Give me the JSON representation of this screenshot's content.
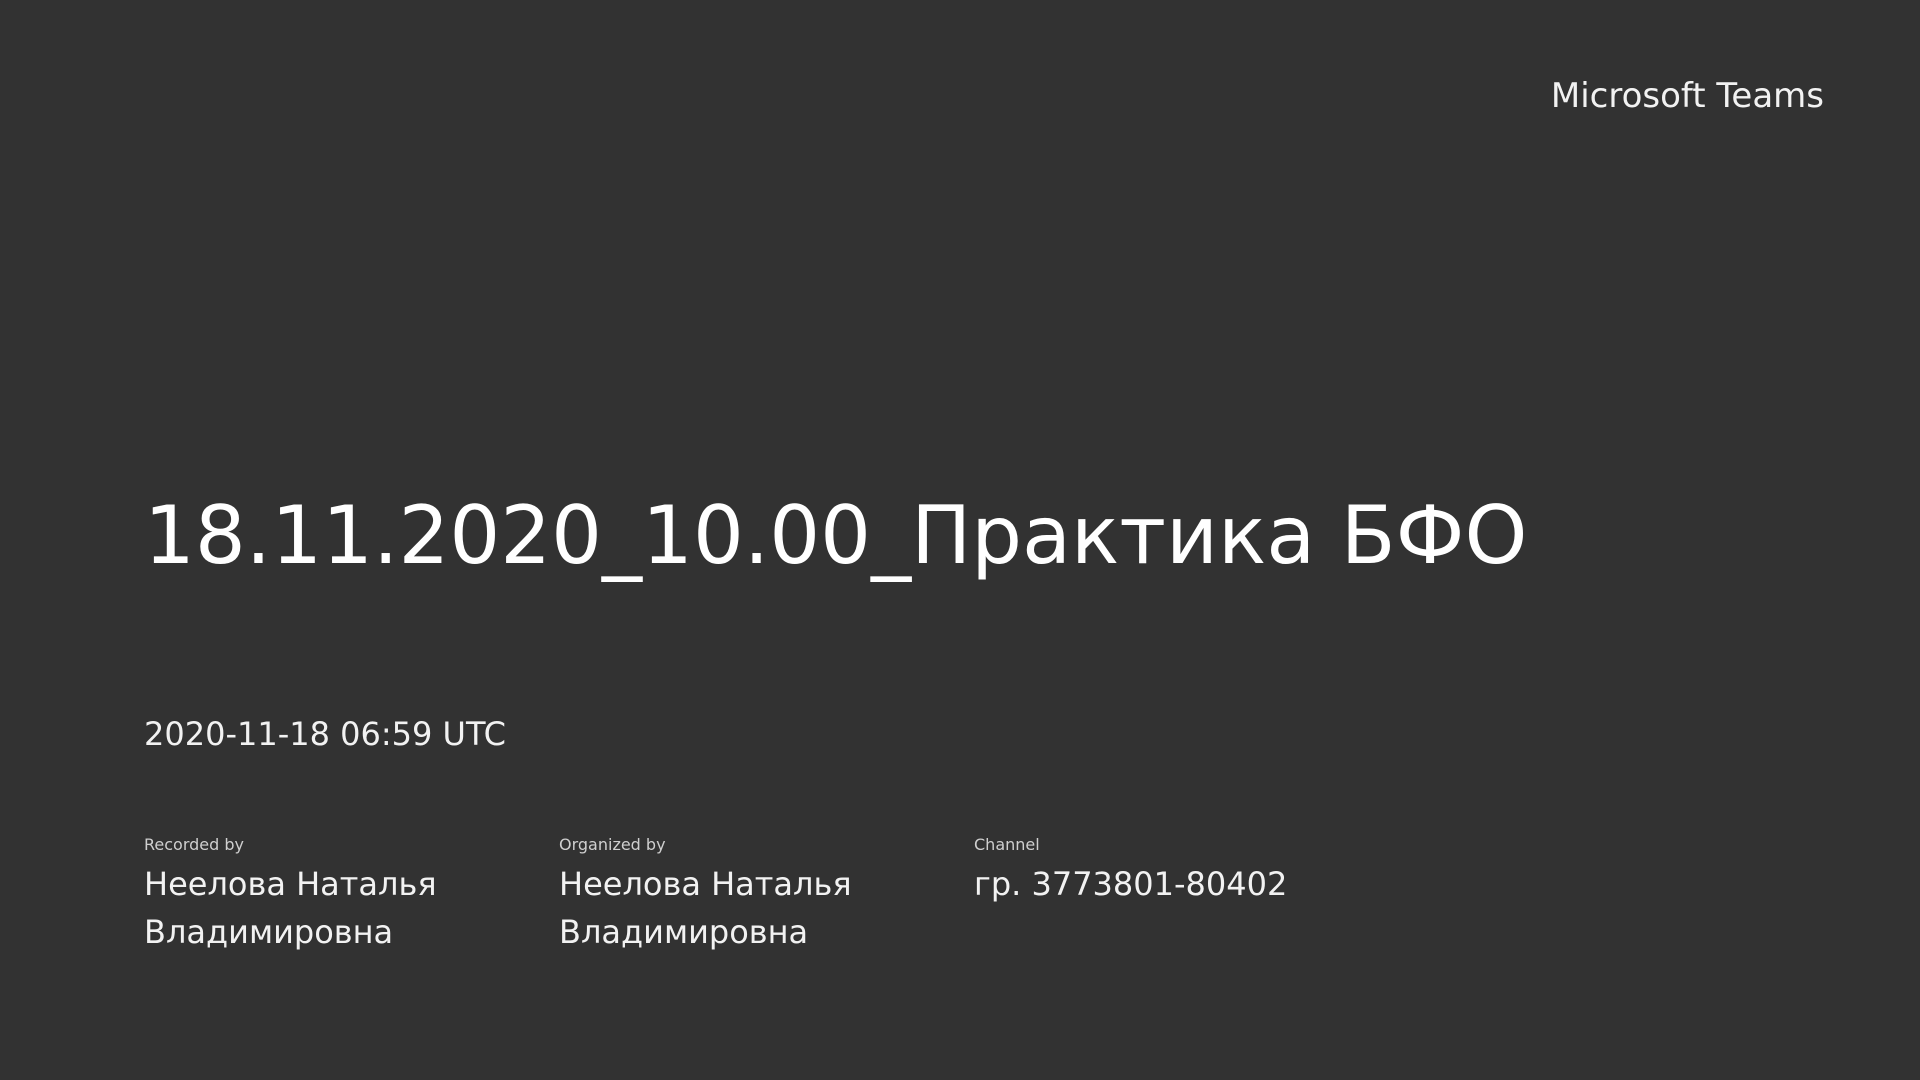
{
  "brand": {
    "name": "Microsoft Teams"
  },
  "recording": {
    "title": "18.11.2020_10.00_Практика БФО",
    "datetime": "2020-11-18 06:59 UTC"
  },
  "meta": [
    {
      "label": "Recorded by",
      "value": "Неелова Наталья Владимировна"
    },
    {
      "label": "Organized by",
      "value": "Неелова Наталья Владимировна"
    },
    {
      "label": "Channel",
      "value": "гр. 3773801-80402"
    }
  ],
  "colors": {
    "background": "#323232",
    "text": "#ffffff"
  }
}
